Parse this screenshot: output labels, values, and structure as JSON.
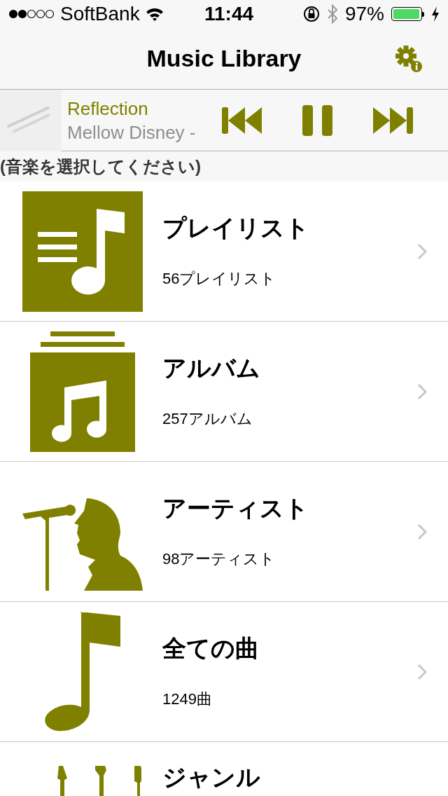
{
  "status_bar": {
    "carrier": "SoftBank",
    "time": "11:44",
    "battery": "97%",
    "charging": true
  },
  "nav": {
    "title": "Music Library"
  },
  "now_playing": {
    "title": "Reflection",
    "artist": "Mellow Disney -",
    "playing": true
  },
  "prompt": "(音楽を選択してください)",
  "categories": [
    {
      "kind": "playlist",
      "title": "プレイリスト",
      "count": "56プレイリスト"
    },
    {
      "kind": "album",
      "title": "アルバム",
      "count": "257アルバム"
    },
    {
      "kind": "artist",
      "title": "アーティスト",
      "count": "98アーティスト"
    },
    {
      "kind": "song",
      "title": "全ての曲",
      "count": "1249曲"
    },
    {
      "kind": "genre",
      "title": "ジャンル"
    }
  ]
}
